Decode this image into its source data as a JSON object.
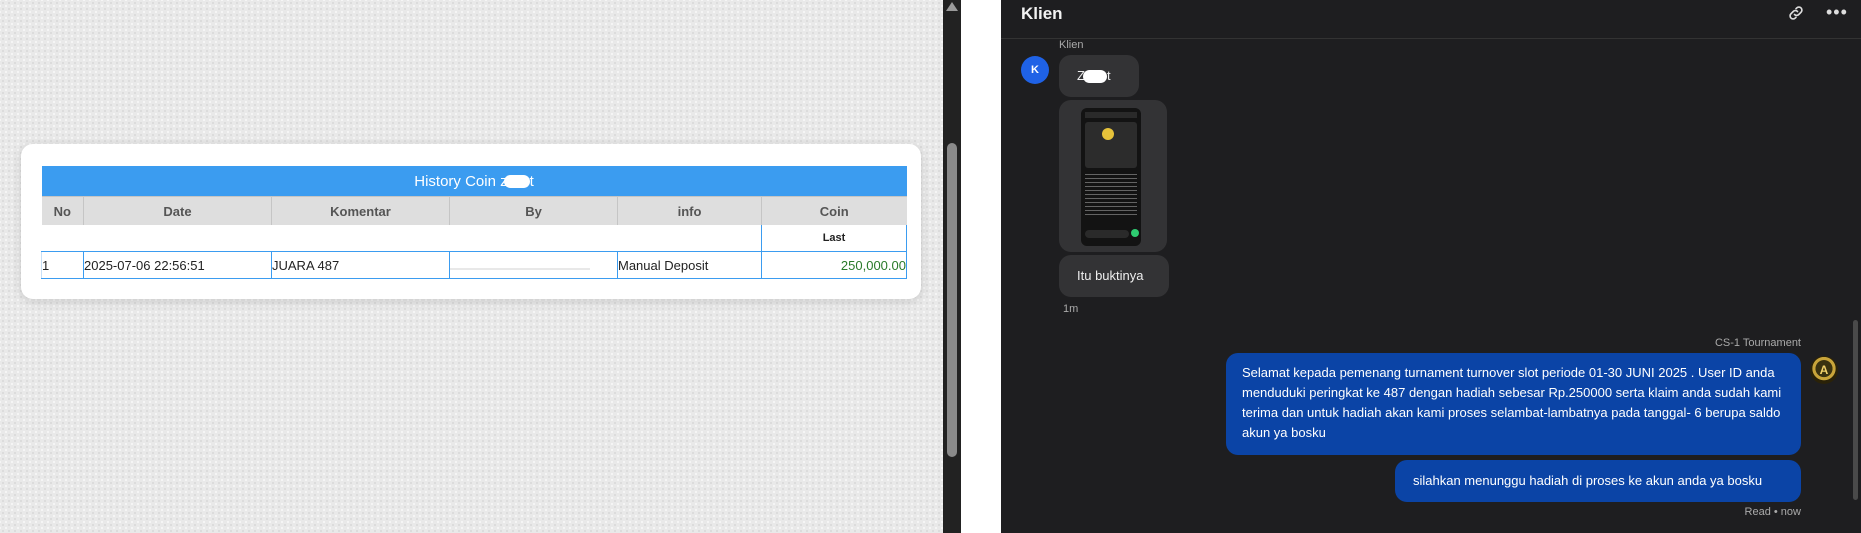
{
  "history": {
    "title": "History Coin z",
    "title_suffix": "t",
    "columns": [
      "No",
      "Date",
      "Komentar",
      "By",
      "info",
      "Coin"
    ],
    "subheader_last": "Last",
    "rows": [
      {
        "no": "1",
        "date": "2025-07-06 22:56:51",
        "komentar": "JUARA 487",
        "by": "",
        "info": "Manual Deposit",
        "coin": "250,000.00"
      }
    ]
  },
  "chat": {
    "title": "Klien",
    "sender_client": "Klien",
    "client_avatar_letter": "K",
    "msg_name_prefix": "Z",
    "msg_name_suffix": "t",
    "msg_proof": "Itu buktinya",
    "time_client": "1m",
    "sender_agent": "CS-1 Tournament",
    "agent_avatar_letter": "A",
    "msg_agent_main": "Selamat kepada pemenang turnament turnover slot periode 01-30 JUNI 2025 . User ID anda menduduki peringkat ke 487 dengan hadiah sebesar Rp.250000 serta klaim anda sudah kami terima dan untuk hadiah akan kami proses selambat-lambatnya pada tanggal- 6 berupa saldo akun ya bosku",
    "msg_agent_wait": "silahkan menunggu hadiah di proses ke akun anda ya bosku",
    "read_status": "Read • now"
  },
  "icons": {
    "link": "link-icon",
    "more": "more-icon",
    "scroll_up": "scroll-up-arrow-icon"
  },
  "colors": {
    "table_header_blue": "#3b9cf0",
    "chat_bg": "#1e1e20",
    "agent_bubble": "#0b44a6",
    "client_bubble": "#333335",
    "avatar_blue": "#1f62e6",
    "coin_green": "#2a7a2a"
  }
}
